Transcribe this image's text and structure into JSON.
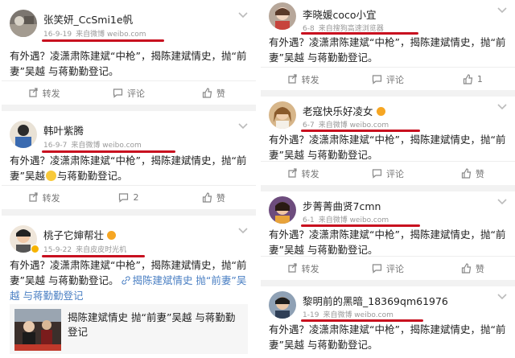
{
  "colors": {
    "accent_underline": "#c8101f",
    "link": "#4a7fc3",
    "meta": "#999999",
    "vip_badge": "#f6b300"
  },
  "left": {
    "posts": [
      {
        "username": "张笑妍_CcSmi1e帆",
        "date": "16-9-19",
        "source": "来自微博 weibo.com",
        "text": "有外遇？凌潇肃陈建斌“中枪”，揭陈建斌情史，抛“前妻”吴越 与蒋勤勤登记。",
        "repost": "转发",
        "comment": "评论",
        "like": "赞"
      },
      {
        "username": "韩叶紫腾",
        "date": "16-9-7",
        "source": "来自微博 weibo.com",
        "text_a": "有外遇？凌潇肃陈建斌“中枪”，揭陈建斌情史，抛“前妻”吴越",
        "text_b": "与蒋勤勤登记。",
        "repost": "转发",
        "comment": "2",
        "like": "赞"
      },
      {
        "username": "桃子它婶帮壮",
        "date": "15-9-22",
        "source": "来自皮皮时光机",
        "text": "有外遇？凌潇肃陈建斌“中枪”，揭陈建斌情史，抛“前妻”吴越 与蒋勤勤登记。",
        "link_a": "揭陈建斌情史 抛“前妻”吴",
        "link_b": "越 与蒋勤勤登记",
        "article_title": "揭陈建斌情史 抛“前妻”吴越 与蒋勤勤登记"
      }
    ]
  },
  "right": {
    "posts": [
      {
        "username": "李晓媛coco小宜",
        "date": "6-8",
        "source": "来自搜狗高速浏览器",
        "text": "有外遇？凌潇肃陈建斌“中枪”，揭陈建斌情史，抛“前妻”吴越 与蒋勤勤登记。",
        "repost": "转发",
        "comment": "评论",
        "like": "1"
      },
      {
        "username": "老寇快乐好凌女",
        "date": "6-7",
        "source": "来自微博 weibo.com",
        "text": "有外遇？凌潇肃陈建斌“中枪”，揭陈建斌情史，抛“前妻”吴越 与蒋勤勤登记。",
        "repost": "转发",
        "comment": "评论",
        "like": "赞"
      },
      {
        "username": "步菁菁曲贤7cmn",
        "date": "6-1",
        "source": "来自微博 weibo.com",
        "text": "有外遇？凌潇肃陈建斌“中枪”，揭陈建斌情史，抛“前妻”吴越 与蒋勤勤登记。",
        "repost": "转发",
        "comment": "评论",
        "like": "赞"
      },
      {
        "username": "黎明前的黑暗_18369qm61976",
        "date": "1-19",
        "source": "来自微博 weibo.com",
        "text": "有外遇？凌潇肃陈建斌“中枪”，揭陈建斌情史，抛“前妻”吴越 与蒋勤勤登记。"
      }
    ]
  }
}
